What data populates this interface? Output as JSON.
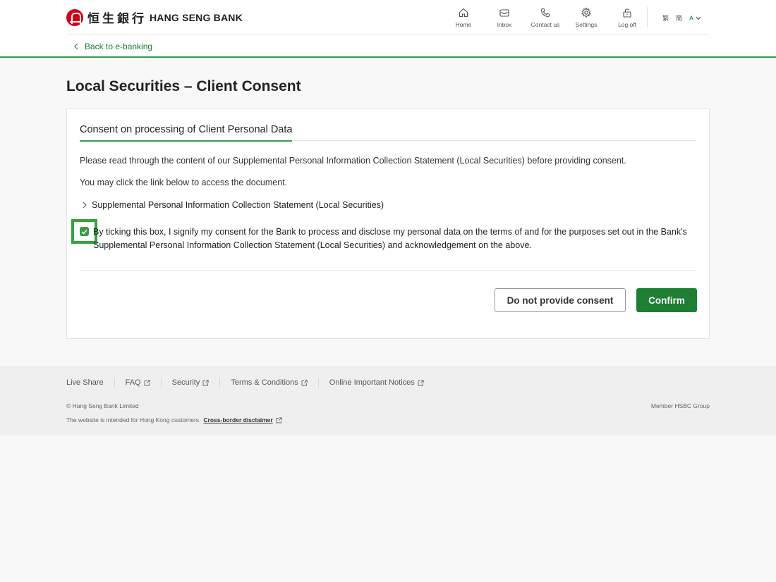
{
  "header": {
    "logo_cn": "恒生銀行",
    "logo_en": "HANG SENG BANK",
    "nav": [
      {
        "label": "Home",
        "icon": "home-icon"
      },
      {
        "label": "Inbox",
        "icon": "inbox-icon"
      },
      {
        "label": "Contact us",
        "icon": "phone-icon"
      },
      {
        "label": "Settings",
        "icon": "gear-icon"
      },
      {
        "label": "Log off",
        "icon": "unlock-icon"
      }
    ],
    "lang_trad": "繁",
    "lang_simp": "簡",
    "font_size": "A"
  },
  "back_link": "Back to e-banking",
  "page_title": "Local Securities – Client Consent",
  "card": {
    "title": "Consent on processing of Client Personal Data",
    "para1": "Please read through the content of our Supplemental Personal Information Collection Statement (Local Securities) before providing consent.",
    "para2": "You may click the link below to access the document.",
    "doc_link": "Supplemental Personal Information Collection Statement (Local Securities)",
    "consent_checked": true,
    "consent_text": "By ticking this box, I signify my consent for the Bank to process and disclose my personal data on the terms of and for the purposes set out in the Bank's Supplemental Personal Information Collection Statement (Local Securities) and acknowledgement on the above.",
    "btn_decline": "Do not provide consent",
    "btn_confirm": "Confirm"
  },
  "footer": {
    "links": [
      "Live Share",
      "FAQ",
      "Security",
      "Terms & Conditions",
      "Online Important Notices"
    ],
    "copyright": "© Hang Seng Bank Limited",
    "member": "Member HSBC Group",
    "disclaimer_prefix": "The website is intended for Hong Kong customers.",
    "disclaimer_link": "Cross-border disclaimer"
  },
  "colors": {
    "brand_green": "#3c9a49",
    "button_green": "#1e7e34",
    "brand_red": "#d40018"
  }
}
